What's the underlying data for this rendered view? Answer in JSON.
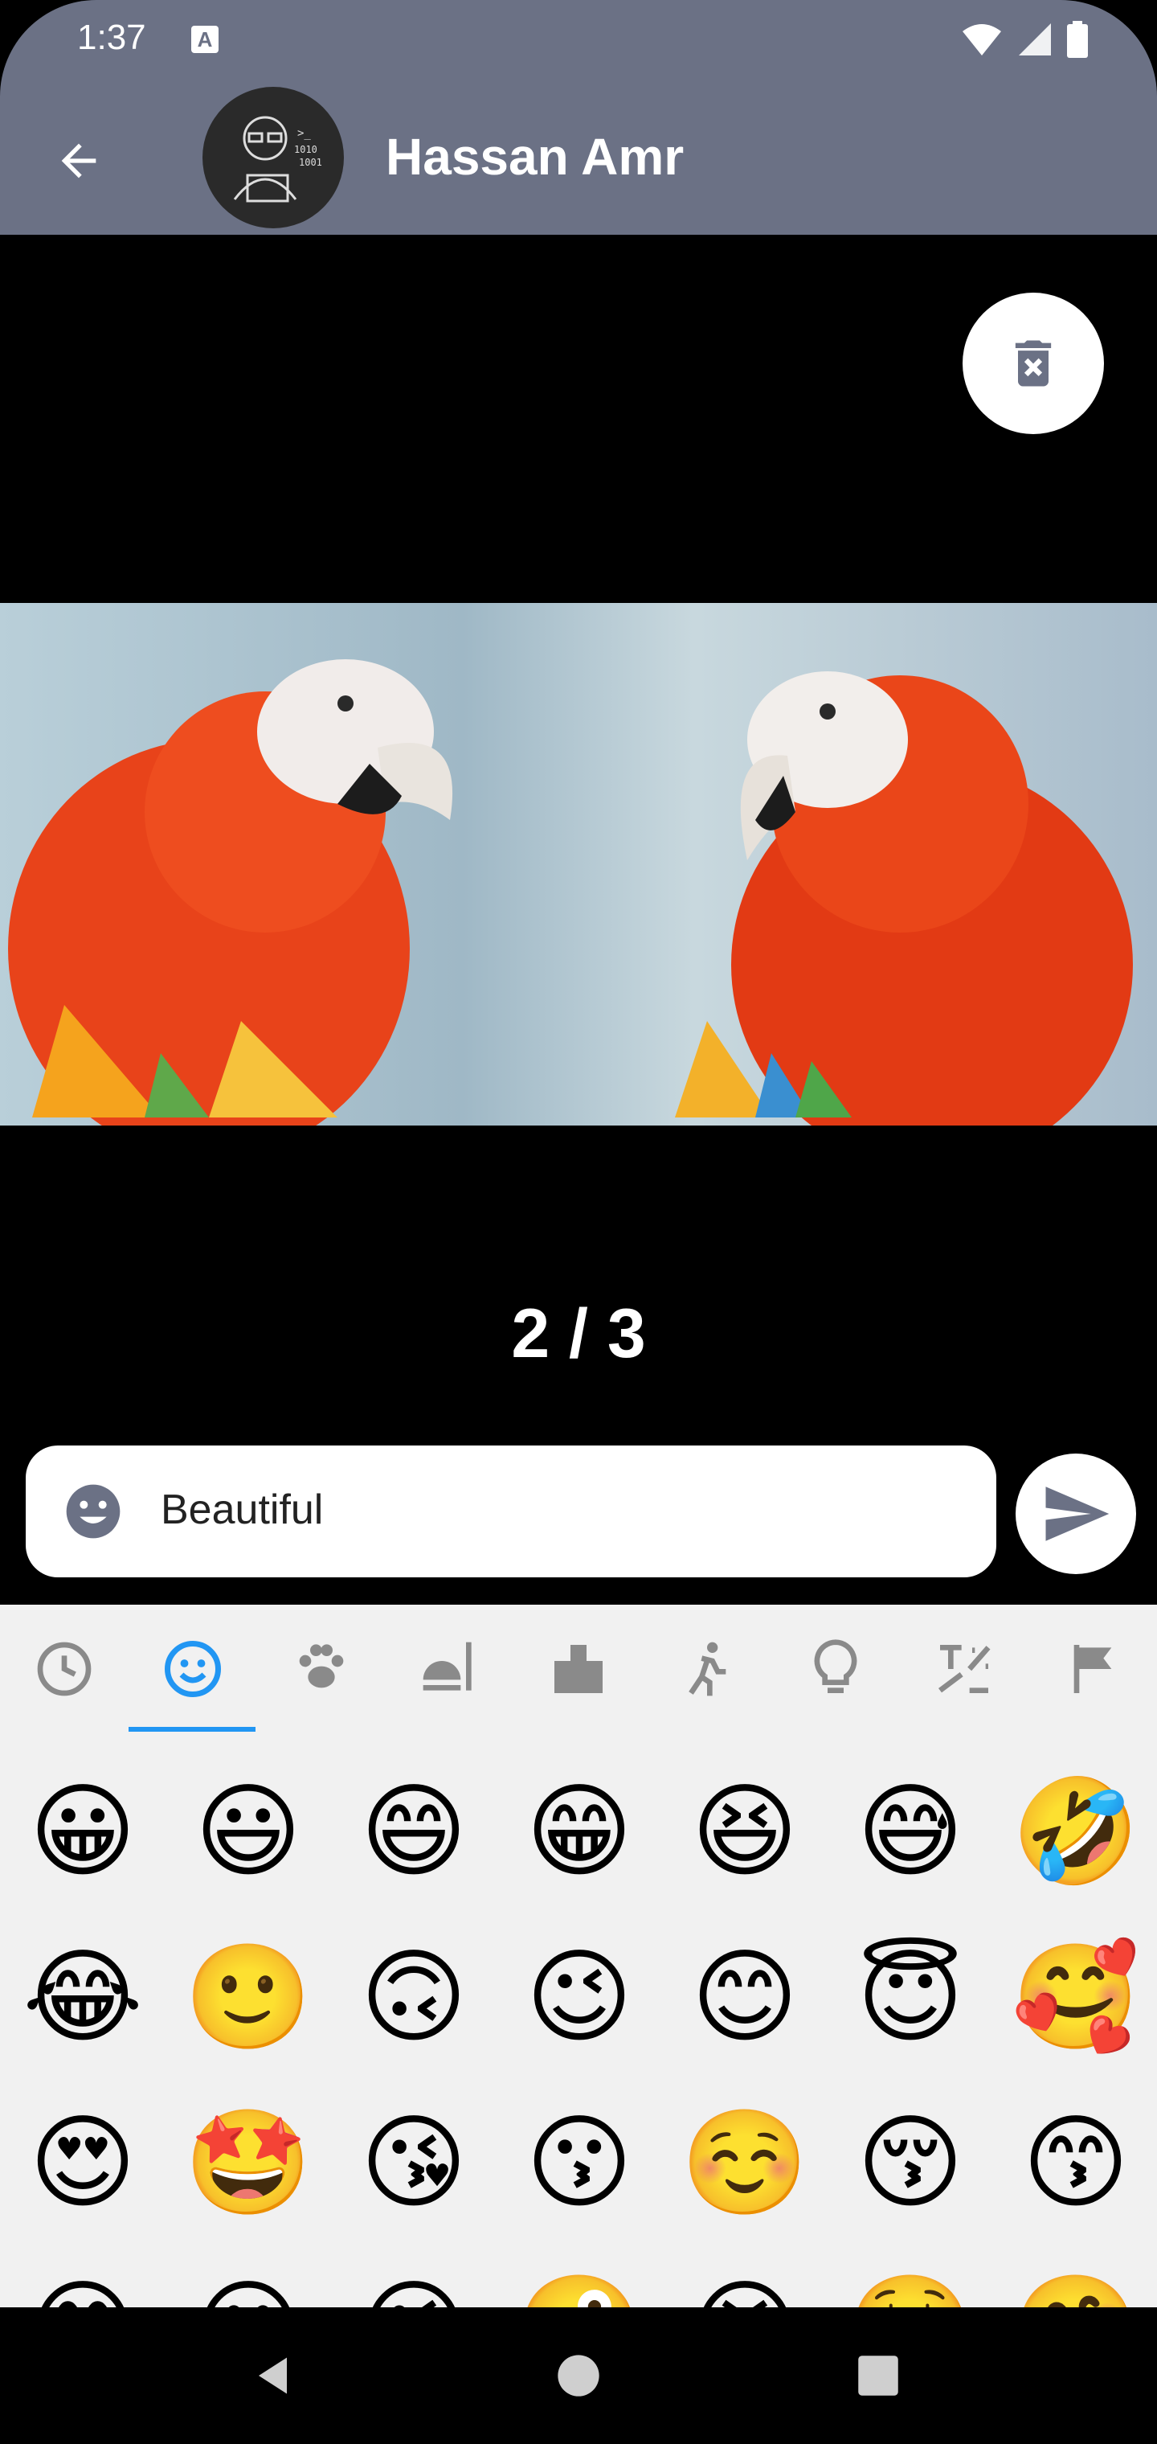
{
  "status": {
    "time": "1:37",
    "notification_letter": "A"
  },
  "header": {
    "contact_name": "Hassan Amr",
    "back_icon": "arrow-back-icon"
  },
  "viewer": {
    "counter": "2 / 3",
    "delete_icon": "trash-x-icon"
  },
  "composer": {
    "message_value": "Beautiful",
    "emoji_icon": "emoji-smile-icon",
    "send_icon": "send-icon"
  },
  "keyboard": {
    "categories": [
      "recent",
      "smileys",
      "animals",
      "food",
      "places",
      "activities",
      "objects",
      "symbols",
      "flags"
    ],
    "selected_category": "smileys",
    "accent": "#2196f3",
    "emojis": [
      "😀",
      "😃",
      "😄",
      "😁",
      "😆",
      "😅",
      "🤣",
      "😂",
      "🙂",
      "🙃",
      "😉",
      "😊",
      "😇",
      "🥰",
      "😍",
      "🤩",
      "😘",
      "😗",
      "☺️",
      "😚",
      "😙",
      "😋",
      "😛",
      "😜",
      "🤪",
      "😝",
      "🤑",
      "🤗"
    ]
  },
  "colors": {
    "appbar": "#6b7185",
    "keyboard_bg": "#f1f1f1"
  }
}
